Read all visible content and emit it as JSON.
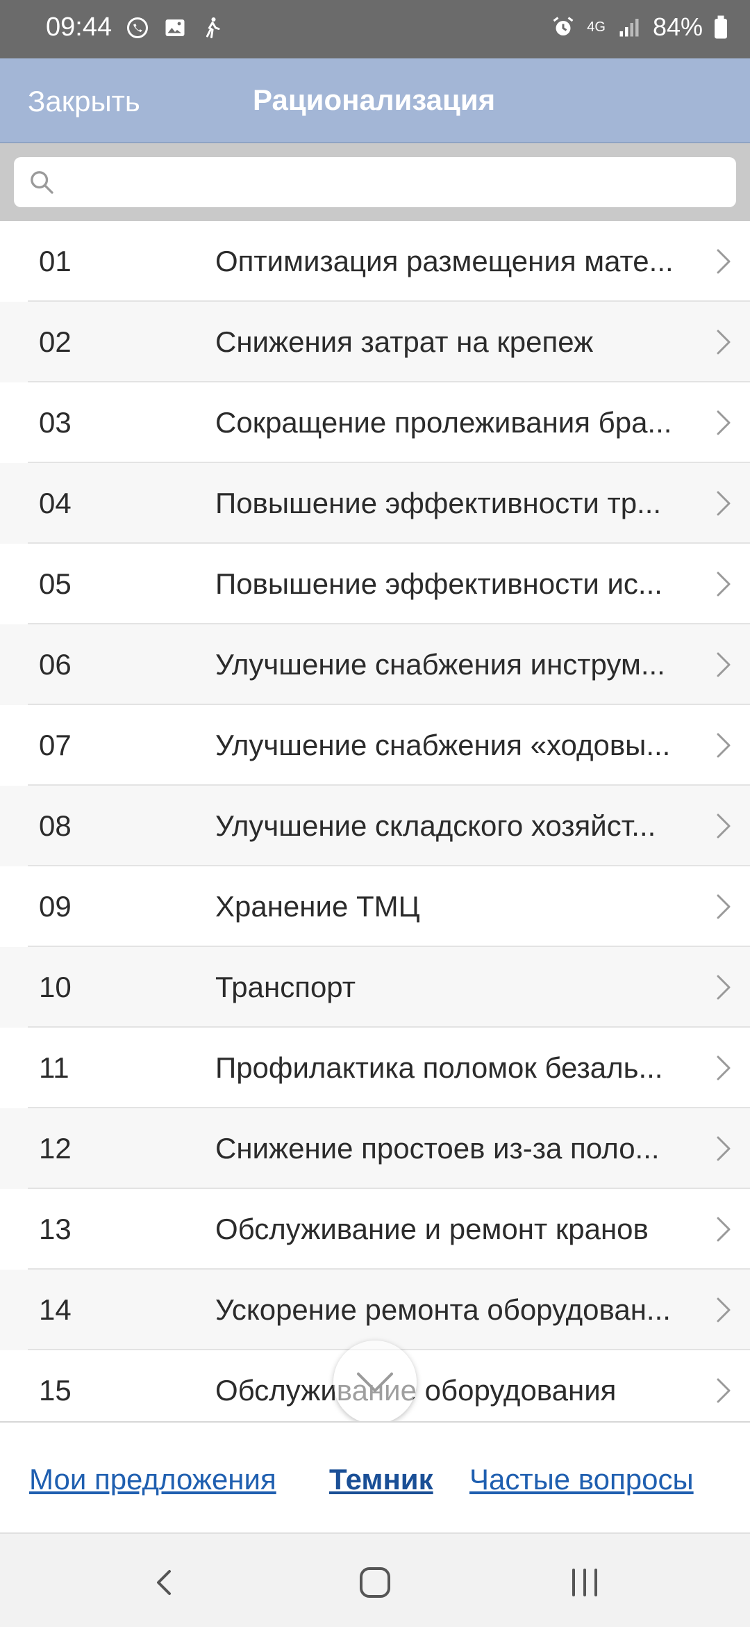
{
  "status_bar": {
    "time": "09:44",
    "network": "4G",
    "battery": "84%"
  },
  "nav": {
    "close_label": "Закрыть",
    "title": "Рационализация"
  },
  "search": {
    "placeholder": ""
  },
  "items": [
    {
      "num": "01",
      "title": "Оптимизация размещения мате..."
    },
    {
      "num": "02",
      "title": "Снижения затрат на крепеж"
    },
    {
      "num": "03",
      "title": "Сокращение пролеживания бра..."
    },
    {
      "num": "04",
      "title": "Повышение эффективности тр..."
    },
    {
      "num": "05",
      "title": "Повышение эффективности ис..."
    },
    {
      "num": "06",
      "title": "Улучшение снабжения инструм..."
    },
    {
      "num": "07",
      "title": "Улучшение снабжения «ходовы..."
    },
    {
      "num": "08",
      "title": "Улучшение складского хозяйст..."
    },
    {
      "num": "09",
      "title": "Хранение ТМЦ"
    },
    {
      "num": "10",
      "title": "Транспорт"
    },
    {
      "num": "11",
      "title": "Профилактика поломок безаль..."
    },
    {
      "num": "12",
      "title": "Снижение простоев из-за поло..."
    },
    {
      "num": "13",
      "title": "Обслуживание и ремонт кранов"
    },
    {
      "num": "14",
      "title": "Ускорение ремонта оборудован..."
    },
    {
      "num": "15",
      "title": "Обслуживание оборудования"
    }
  ],
  "tabs": {
    "my_proposals": "Мои предложения",
    "topics": "Темник",
    "faq": "Частые вопросы"
  },
  "colors": {
    "nav_bg": "#a3b6d6",
    "link": "#1f5fb0",
    "status_bg": "#6b6b6b"
  }
}
